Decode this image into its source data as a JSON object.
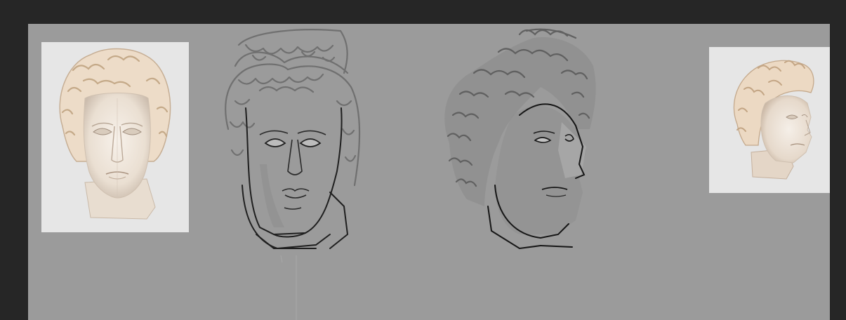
{
  "app": {
    "background_color": "#262626",
    "canvas_color": "#9b9b9b",
    "reference_panel_color": "#e6e6e6",
    "marble_color": "#efe6dc",
    "sketch_line_color": "#222222",
    "sketch_shade_color": "#7a7a7a"
  },
  "canvas": {
    "items": [
      {
        "icon": "marble-bust-front-reference-icon"
      },
      {
        "icon": "front-view-head-sketch-icon"
      },
      {
        "icon": "three-quarter-head-sketch-icon"
      },
      {
        "icon": "marble-bust-three-quarter-reference-icon"
      }
    ]
  }
}
